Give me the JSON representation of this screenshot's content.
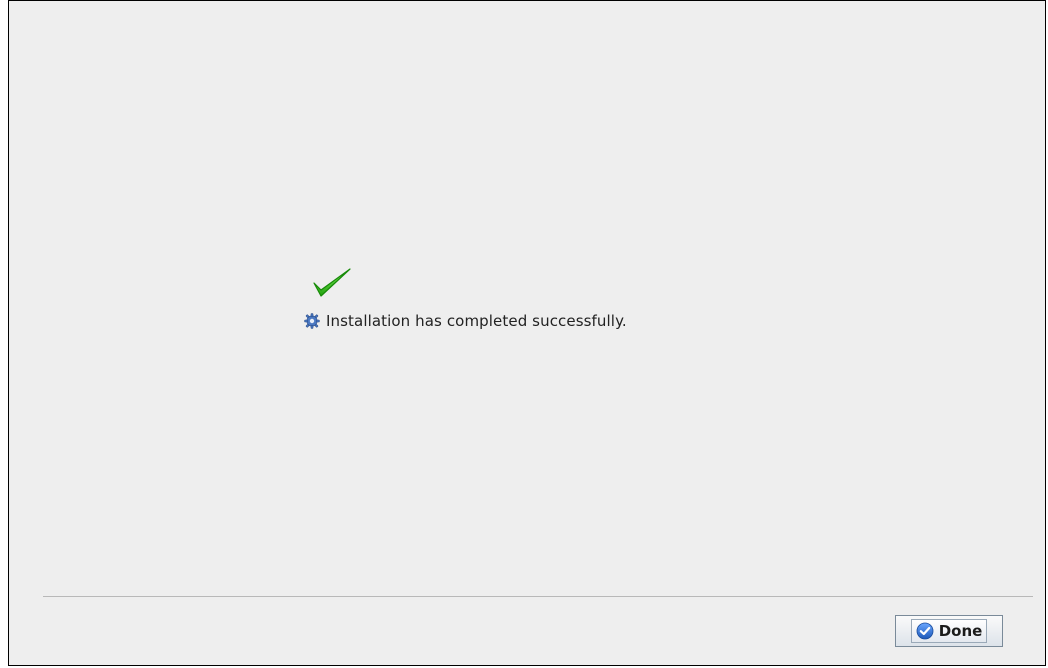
{
  "status": {
    "message": "Installation has completed successfully.",
    "success_icon": "checkmark-icon",
    "info_icon": "gear-icon"
  },
  "footer": {
    "done_label": "Done",
    "done_icon": "check-circle-icon"
  },
  "colors": {
    "check_green": "#3cc41a",
    "gear_blue": "#4a78c2",
    "done_icon_blue": "#2f6fd0",
    "background": "#eeeeee"
  }
}
